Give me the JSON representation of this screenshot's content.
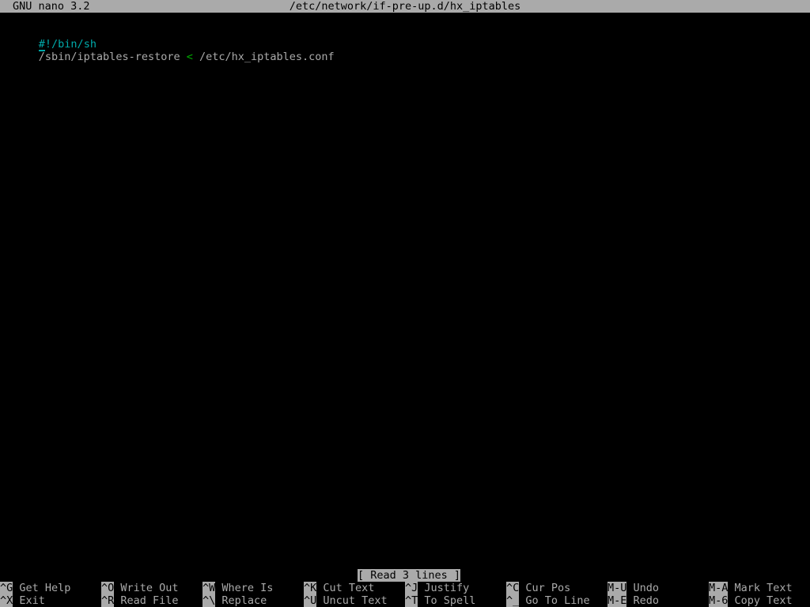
{
  "titlebar": {
    "version": "GNU nano 3.2",
    "filename": "/etc/network/if-pre-up.d/hx_iptables"
  },
  "editor": {
    "lines": [
      {
        "cursor_char": "#",
        "rest_cyan": "!/bin/sh",
        "color": "cyan"
      },
      {
        "pre": "/sbin/iptables-restore ",
        "operator": "<",
        "post": " /etc/hx_iptables.conf",
        "color": "grey"
      }
    ]
  },
  "status": {
    "message": "[ Read 3 lines ]"
  },
  "shortcuts": {
    "row1": [
      {
        "key": "^G",
        "label": "Get Help"
      },
      {
        "key": "^O",
        "label": "Write Out"
      },
      {
        "key": "^W",
        "label": "Where Is"
      },
      {
        "key": "^K",
        "label": "Cut Text"
      },
      {
        "key": "^J",
        "label": "Justify"
      },
      {
        "key": "^C",
        "label": "Cur Pos"
      },
      {
        "key": "M-U",
        "label": "Undo"
      },
      {
        "key": "M-A",
        "label": "Mark Text"
      }
    ],
    "row2": [
      {
        "key": "^X",
        "label": "Exit"
      },
      {
        "key": "^R",
        "label": "Read File"
      },
      {
        "key": "^\\",
        "label": "Replace"
      },
      {
        "key": "^U",
        "label": "Uncut Text"
      },
      {
        "key": "^T",
        "label": "To Spell"
      },
      {
        "key": "^_",
        "label": "Go To Line"
      },
      {
        "key": "M-E",
        "label": "Redo"
      },
      {
        "key": "M-6",
        "label": "Copy Text"
      }
    ]
  },
  "colors": {
    "background": "#000000",
    "foreground": "#aaaaaa",
    "bar_background": "#aaaaaa",
    "bar_foreground": "#000000",
    "comment": "#00aaaa",
    "operator": "#00aa00"
  }
}
